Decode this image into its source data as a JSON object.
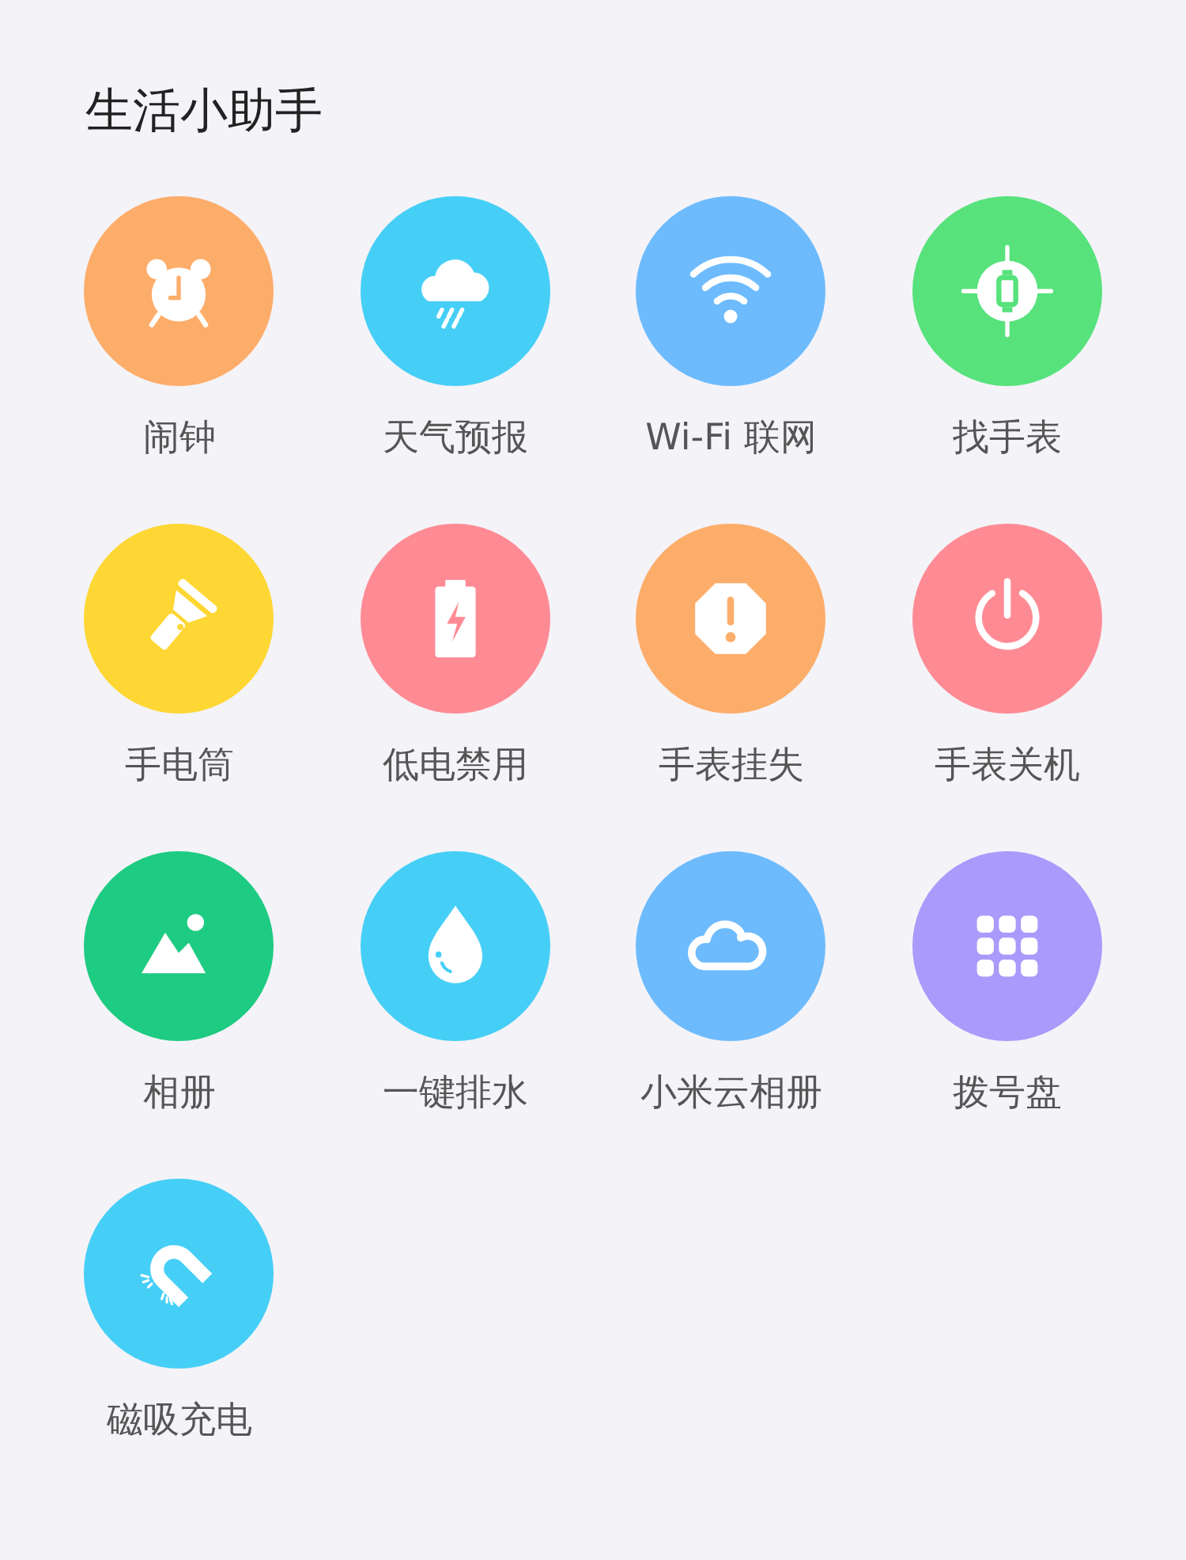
{
  "title": "生活小助手",
  "items": [
    {
      "label": "闹钟",
      "kind": "alarm",
      "color": "#fdad6a"
    },
    {
      "label": "天气预报",
      "kind": "weather",
      "color": "#46cff6"
    },
    {
      "label": "Wi-Fi 联网",
      "kind": "wifi",
      "color": "#6dbbfd"
    },
    {
      "label": "找手表",
      "kind": "find",
      "color": "#57e27c"
    },
    {
      "label": "手电筒",
      "kind": "flashlight",
      "color": "#fed734"
    },
    {
      "label": "低电禁用",
      "kind": "battery",
      "color": "#fe8b94"
    },
    {
      "label": "手表挂失",
      "kind": "warning",
      "color": "#fdad6a"
    },
    {
      "label": "手表关机",
      "kind": "power",
      "color": "#fe8b94"
    },
    {
      "label": "相册",
      "kind": "photos",
      "color": "#1ecb82"
    },
    {
      "label": "一键排水",
      "kind": "drop",
      "color": "#46cff6"
    },
    {
      "label": "小米云相册",
      "kind": "cloud",
      "color": "#6dbbfd"
    },
    {
      "label": "拨号盘",
      "kind": "dialpad",
      "color": "#a99afb"
    },
    {
      "label": "磁吸充电",
      "kind": "magnet",
      "color": "#46cff6"
    }
  ]
}
